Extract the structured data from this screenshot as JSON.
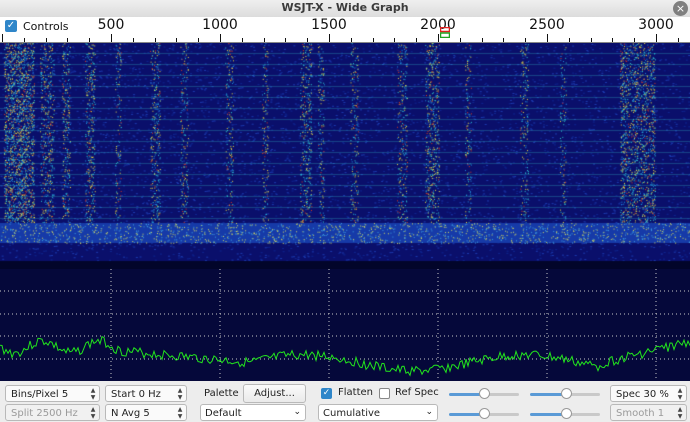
{
  "window": {
    "title": "WSJT-X - Wide Graph",
    "close_glyph": "×"
  },
  "ruler": {
    "controls_label": "Controls",
    "controls_checked": true,
    "ticks": [
      {
        "label": "500",
        "hz": 500
      },
      {
        "label": "1000",
        "hz": 1000
      },
      {
        "label": "1500",
        "hz": 1500
      },
      {
        "label": "2000",
        "hz": 2000
      },
      {
        "label": "2500",
        "hz": 2500
      },
      {
        "label": "3000",
        "hz": 3000
      }
    ]
  },
  "controls": {
    "bins_pixel": "Bins/Pixel  5",
    "split": "Split  2500  Hz",
    "start": "Start 0 Hz",
    "n_avg": "N Avg 5",
    "palette_label": "Palette",
    "adjust_label": "Adjust...",
    "palette_value": "Default",
    "flatten_label": "Flatten",
    "flatten_checked": true,
    "ref_spec_label": "Ref Spec",
    "ref_spec_checked": false,
    "spectrum_mode": "Cumulative",
    "spec_pct": "Spec 30 %",
    "smooth": "Smooth  1"
  },
  "colors": {
    "waterfall_bg": "#0a0f6b",
    "spectrum_bg": "#05083a",
    "trace": "#22e51d",
    "accent": "#2f86c9"
  }
}
